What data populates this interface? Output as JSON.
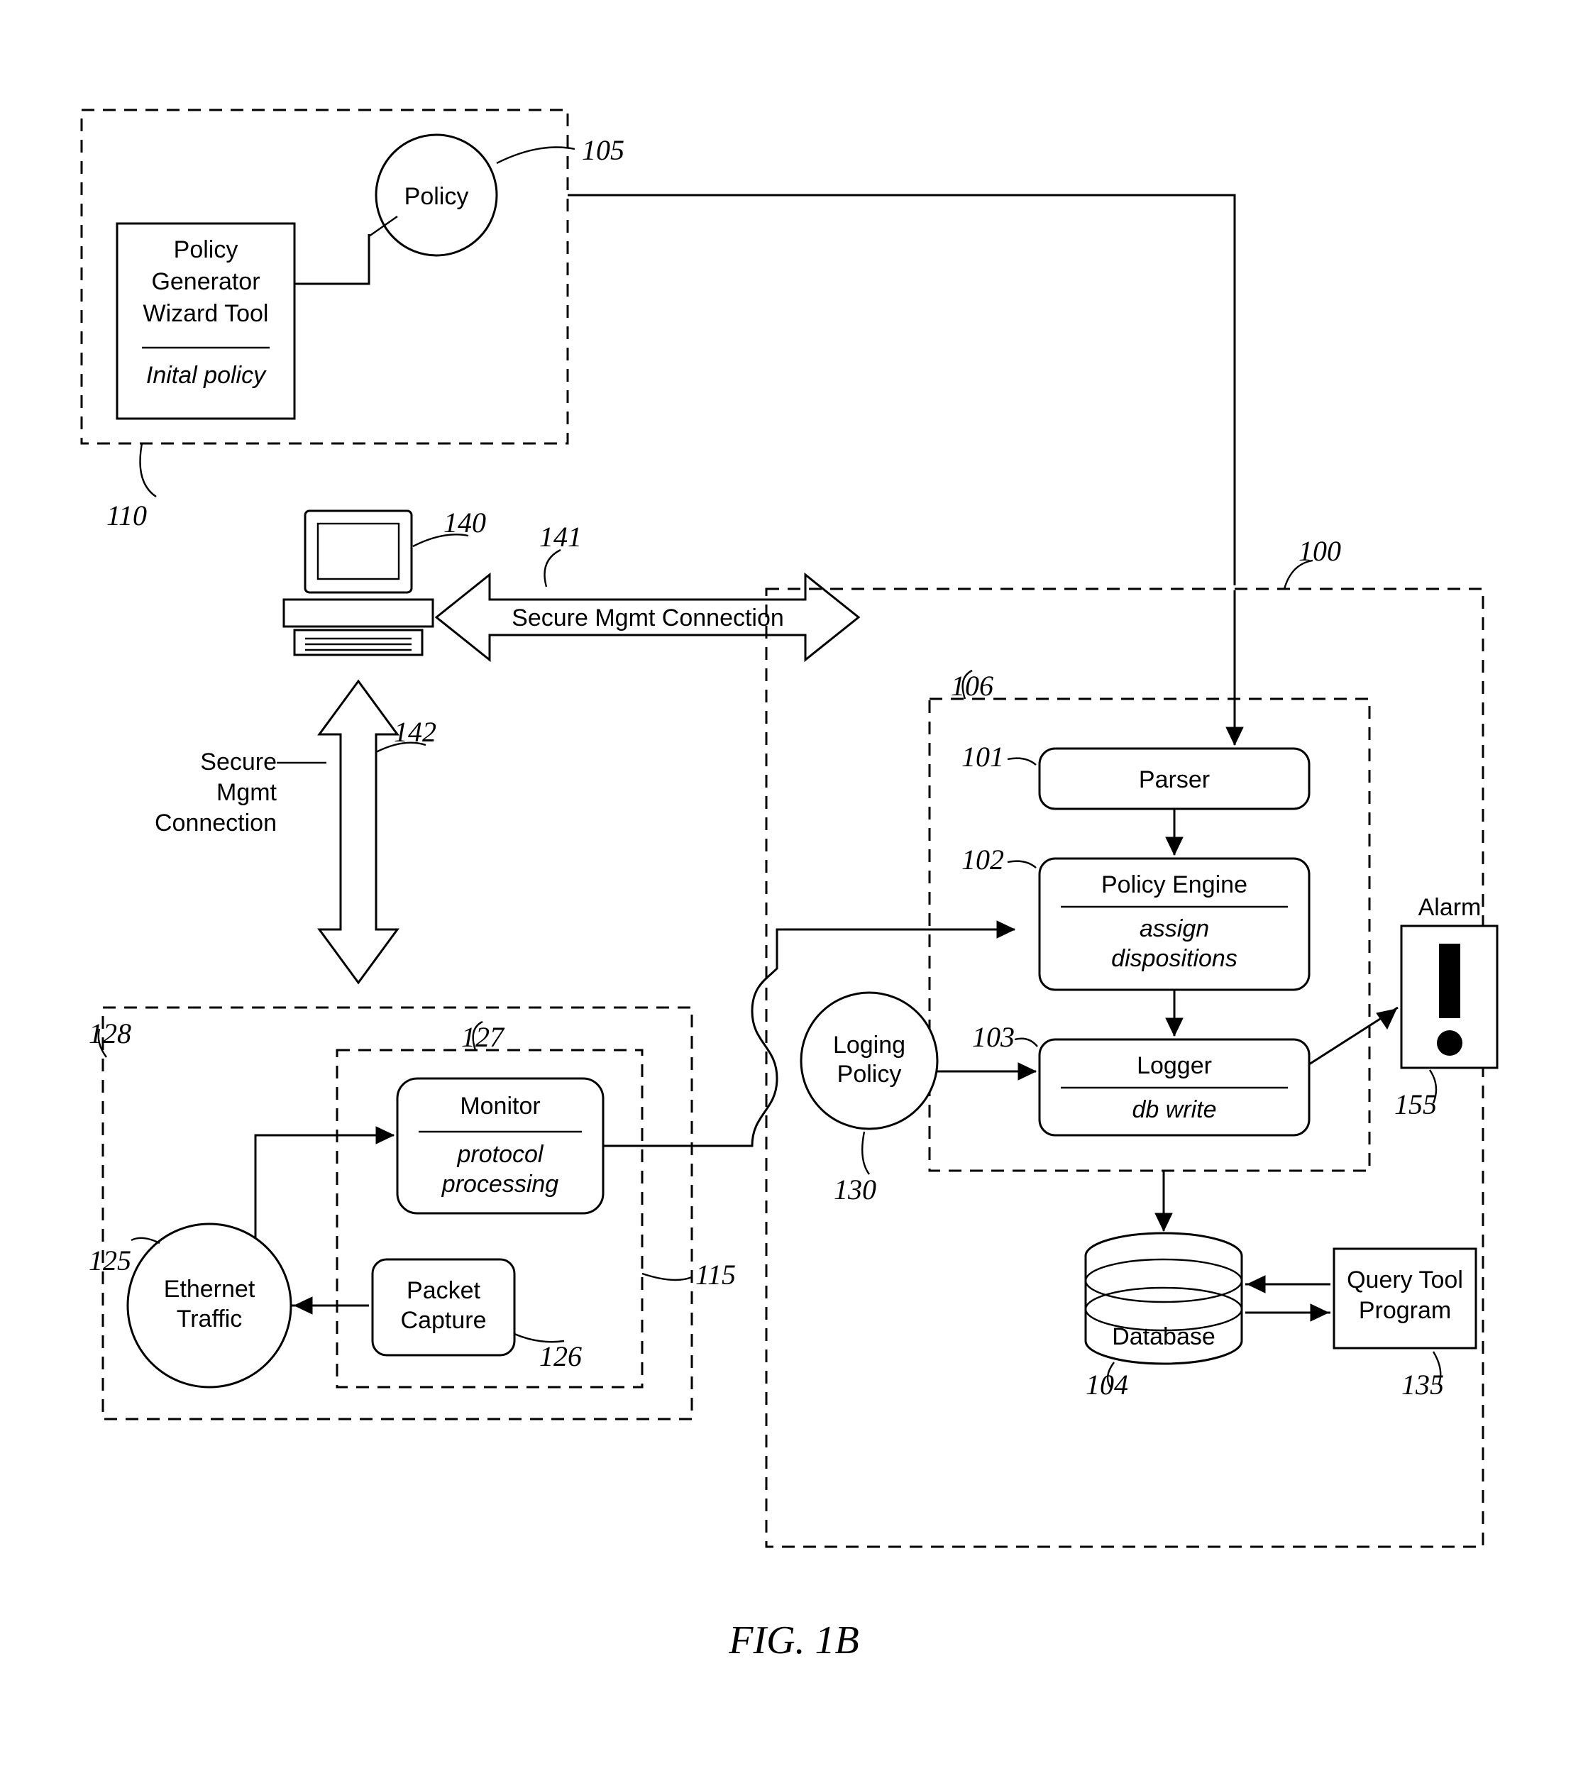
{
  "figure_caption": "FIG. 1B",
  "policy_block": {
    "wizard": [
      "Policy",
      "Generator",
      "Wizard Tool"
    ],
    "wizard_it": "Inital policy",
    "policy_circle": "Policy"
  },
  "ref": {
    "r105": "105",
    "r110": "110",
    "r140": "140",
    "r141": "141",
    "r142": "142",
    "r128": "128",
    "r127": "127",
    "r115": "115",
    "r125": "125",
    "r126": "126",
    "r100": "100",
    "r106": "106",
    "r101": "101",
    "r102": "102",
    "r103": "103",
    "r104": "104",
    "r130": "130",
    "r135": "135",
    "r155": "155"
  },
  "conn": {
    "secure_mgmt_conn": "Secure Mgmt Connection",
    "secure": "Secure",
    "mgmt": "Mgmt",
    "connection": "Connection"
  },
  "monitor_block": {
    "monitor": "Monitor",
    "monitor_it": [
      "protocol",
      "processing"
    ],
    "packet": [
      "Packet",
      "Capture"
    ],
    "ethernet": [
      "Ethernet",
      "Traffic"
    ]
  },
  "engine": {
    "parser": "Parser",
    "policy_engine": "Policy Engine",
    "policy_engine_it": [
      "assign",
      "dispositions"
    ],
    "logger": "Logger",
    "logger_it": "db write",
    "logging_policy": [
      "Loging",
      "Policy"
    ],
    "database": "Database",
    "query_tool": [
      "Query Tool",
      "Program"
    ],
    "alarm": "Alarm"
  }
}
